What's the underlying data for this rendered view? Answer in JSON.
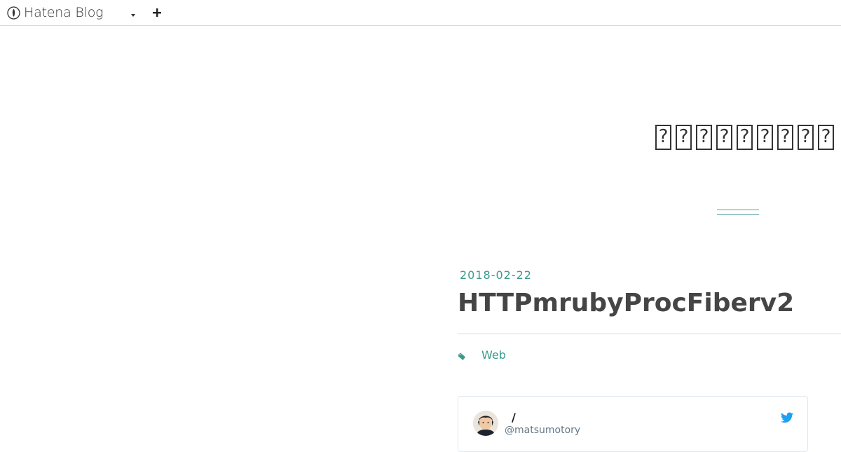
{
  "topbar": {
    "logo_text": "Hatena Blog",
    "logo_icon": "hatena-pen-icon",
    "dropdown_icon": "caret-down-icon",
    "add_icon": "plus-icon"
  },
  "blog": {
    "title_glyphs": [
      "?",
      "?",
      "?",
      "?",
      "?",
      "?",
      "?",
      "?",
      "?"
    ]
  },
  "entry": {
    "date": "2018-02-22",
    "title": "HTTPmrubyProcFiberv2",
    "category": "Web",
    "category_icon": "tag-icon"
  },
  "tweet": {
    "name": "/",
    "handle": "@matsumotory",
    "bird_icon": "twitter-bird-icon"
  },
  "colors": {
    "accent": "#3a9a8c",
    "title_rule": "#5b9ea6",
    "text": "#454545",
    "twitter_blue": "#1da1f2",
    "border": "#d8d8d8"
  }
}
